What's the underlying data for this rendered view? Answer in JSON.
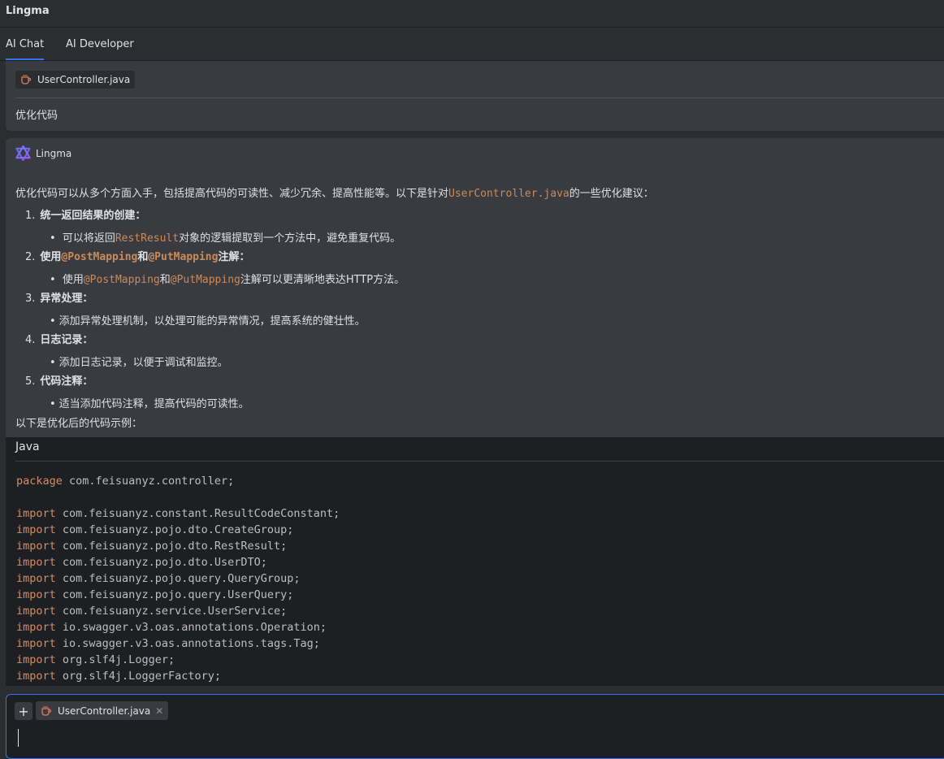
{
  "app": {
    "title": "Lingma"
  },
  "tabs": [
    {
      "label": "AI Chat",
      "active": true
    },
    {
      "label": "AI Developer",
      "active": false
    }
  ],
  "user_message": {
    "file_chip": "UserController.java",
    "text": "优化代码"
  },
  "assistant": {
    "name": "Lingma",
    "intro_prefix": "优化代码可以从多个方面入手，包括提高代码的可读性、减少冗余、提高性能等。以下是针对",
    "intro_code": "UserController.java",
    "intro_suffix": "的一些优化建议：",
    "items": [
      {
        "num": "1.",
        "title": "统一返回结果的创建：",
        "sub_prefix": "可以将返回",
        "sub_code": "RestResult",
        "sub_suffix": "对象的逻辑提取到一个方法中，避免重复代码。"
      },
      {
        "num": "2.",
        "title_prefix": "使用",
        "title_code1": "@PostMapping",
        "title_mid": "和",
        "title_code2": "@PutMapping",
        "title_suffix": "注解：",
        "sub_prefix": "使用",
        "sub_code1": "@PostMapping",
        "sub_mid": "和",
        "sub_code2": "@PutMapping",
        "sub_suffix": "注解可以更清晰地表达HTTP方法。"
      },
      {
        "num": "3.",
        "title": "异常处理：",
        "sub": "添加异常处理机制，以处理可能的异常情况，提高系统的健壮性。"
      },
      {
        "num": "4.",
        "title": "日志记录：",
        "sub": "添加日志记录，以便于调试和监控。"
      },
      {
        "num": "5.",
        "title": "代码注释：",
        "sub": "适当添加代码注释，提高代码的可读性。"
      }
    ],
    "outro": "以下是优化后的代码示例："
  },
  "code_block": {
    "language": "Java",
    "lines": [
      {
        "kw": "package",
        "rest": " com.feisuanyz.controller;"
      },
      {
        "kw": "",
        "rest": ""
      },
      {
        "kw": "import",
        "rest": " com.feisuanyz.constant.ResultCodeConstant;"
      },
      {
        "kw": "import",
        "rest": " com.feisuanyz.pojo.dto.CreateGroup;"
      },
      {
        "kw": "import",
        "rest": " com.feisuanyz.pojo.dto.RestResult;"
      },
      {
        "kw": "import",
        "rest": " com.feisuanyz.pojo.dto.UserDTO;"
      },
      {
        "kw": "import",
        "rest": " com.feisuanyz.pojo.query.QueryGroup;"
      },
      {
        "kw": "import",
        "rest": " com.feisuanyz.pojo.query.UserQuery;"
      },
      {
        "kw": "import",
        "rest": " com.feisuanyz.service.UserService;"
      },
      {
        "kw": "import",
        "rest": " io.swagger.v3.oas.annotations.Operation;"
      },
      {
        "kw": "import",
        "rest": " io.swagger.v3.oas.annotations.tags.Tag;"
      },
      {
        "kw": "import",
        "rest": " org.slf4j.Logger;"
      },
      {
        "kw": "import",
        "rest": " org.slf4j.LoggerFactory;"
      }
    ]
  },
  "input": {
    "file_chip": "UserController.java",
    "close_glyph": "✕",
    "add_glyph": "+"
  },
  "colors": {
    "accent": "#3574f0",
    "code_keyword": "#cf8e6d",
    "inline_code": "#c98b5b",
    "card_bg": "#393b40"
  }
}
